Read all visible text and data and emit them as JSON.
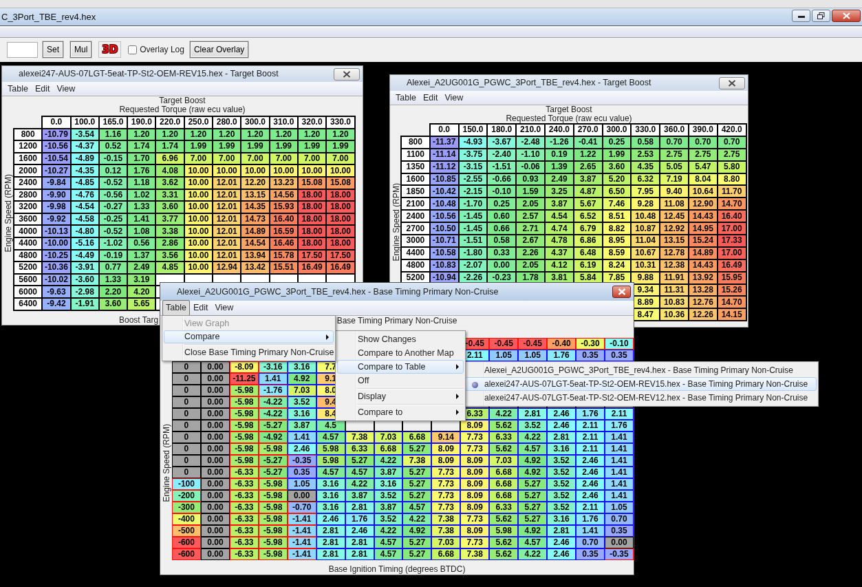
{
  "app": {
    "title": "C_3Port_TBE_rev4.hex",
    "toolbar": {
      "set": "Set",
      "mul": "Mul",
      "three_d": "3D",
      "overlay_log": {
        "label": "Overlay Log",
        "checked": false
      },
      "clear_overlay": "Clear Overlay"
    }
  },
  "windows": [
    {
      "kind": "heatmap",
      "active": false,
      "title": "alexei247-AUS-07LGT-5eat-TP-St2-OEM-REV15.hex - Target Boost",
      "menus": [
        {
          "label": "Table",
          "open": false
        },
        {
          "label": "Edit",
          "open": false
        },
        {
          "label": "View",
          "open": false
        }
      ],
      "chart_title": "Target Boost",
      "x_axis_title": "Requested Torque (raw ecu value)",
      "y_axis_title": "Engine Speed (RPM)",
      "columns": [
        "0.0",
        "100.0",
        "165.0",
        "190.0",
        "220.0",
        "250.0",
        "280.0",
        "300.0",
        "310.0",
        "320.0",
        "330.0"
      ],
      "rows": [
        {
          "label": "800",
          "cells": [
            "-10.79",
            "-3.54",
            "1.16",
            "1.20",
            "1.20",
            "1.20",
            "1.20",
            "1.20",
            "1.20",
            "1.20",
            "1.20"
          ]
        },
        {
          "label": "1200",
          "cells": [
            "-10.56",
            "-4.37",
            "0.52",
            "1.74",
            "1.74",
            "1.99",
            "1.99",
            "1.99",
            "1.99",
            "1.99",
            "1.99"
          ]
        },
        {
          "label": "1600",
          "cells": [
            "-10.54",
            "-4.89",
            "-0.15",
            "1.70",
            "6.96",
            "7.00",
            "7.00",
            "7.00",
            "7.00",
            "7.00",
            "7.00"
          ]
        },
        {
          "label": "2000",
          "cells": [
            "-10.27",
            "-4.35",
            "0.12",
            "1.76",
            "4.08",
            "10.00",
            "10.00",
            "10.00",
            "10.00",
            "10.00",
            "10.00"
          ]
        },
        {
          "label": "2400",
          "cells": [
            "-9.84",
            "-4.85",
            "-0.52",
            "1.18",
            "3.62",
            "10.00",
            "12.01",
            "12.20",
            "13.23",
            "15.08",
            "15.08"
          ]
        },
        {
          "label": "2800",
          "cells": [
            "-9.90",
            "-4.76",
            "-0.56",
            "1.02",
            "3.31",
            "10.00",
            "12.01",
            "13.15",
            "14.56",
            "18.00",
            "18.00"
          ]
        },
        {
          "label": "3200",
          "cells": [
            "-9.98",
            "-4.54",
            "-0.27",
            "1.33",
            "3.60",
            "10.00",
            "12.01",
            "14.35",
            "15.93",
            "18.00",
            "18.00"
          ]
        },
        {
          "label": "3600",
          "cells": [
            "-9.92",
            "-4.58",
            "-0.25",
            "1.41",
            "3.77",
            "10.00",
            "12.01",
            "14.73",
            "16.40",
            "18.00",
            "18.00"
          ]
        },
        {
          "label": "4000",
          "cells": [
            "-10.13",
            "-4.80",
            "-0.52",
            "1.08",
            "3.38",
            "10.00",
            "12.01",
            "14.89",
            "16.59",
            "18.00",
            "18.00"
          ]
        },
        {
          "label": "4400",
          "cells": [
            "-10.00",
            "-5.16",
            "-1.02",
            "0.56",
            "2.86",
            "10.00",
            "12.01",
            "14.54",
            "16.46",
            "18.00",
            "18.00"
          ]
        },
        {
          "label": "4800",
          "cells": [
            "-10.25",
            "-4.49",
            "-0.19",
            "1.37",
            "3.56",
            "10.00",
            "12.01",
            "13.94",
            "15.78",
            "17.50",
            "17.50"
          ]
        },
        {
          "label": "5200",
          "cells": [
            "-10.36",
            "-3.91",
            "0.77",
            "2.49",
            "4.85",
            "10.00",
            "12.94",
            "13.42",
            "15.51",
            "16.49",
            "16.49"
          ]
        },
        {
          "label": "5600",
          "cells": [
            "-10.02",
            "-3.60",
            "1.33",
            "3.19",
            null,
            null,
            null,
            null,
            null,
            null,
            null
          ]
        },
        {
          "label": "6000",
          "cells": [
            "-9.63",
            "-2.98",
            "2.20",
            "4.20",
            null,
            null,
            null,
            null,
            null,
            null,
            null
          ]
        },
        {
          "label": "6400",
          "cells": [
            "-9.42",
            "-1.91",
            "3.60",
            "5.65",
            null,
            null,
            null,
            null,
            null,
            null,
            null
          ]
        }
      ],
      "footer": "Boost Targ"
    },
    {
      "kind": "heatmap",
      "active": false,
      "title": "Alexei_A2UG001G_PGWC_3Port_TBE_rev4.hex - Target Boost",
      "menus": [
        {
          "label": "Table",
          "open": false
        },
        {
          "label": "Edit",
          "open": false
        },
        {
          "label": "View",
          "open": false
        }
      ],
      "chart_title": "Target Boost",
      "x_axis_title": "Requested Torque (raw ecu value)",
      "y_axis_title": "Engine Speed (RPM)",
      "columns": [
        "0.0",
        "150.0",
        "180.0",
        "210.0",
        "240.0",
        "270.0",
        "300.0",
        "330.0",
        "360.0",
        "390.0",
        "420.0"
      ],
      "rows": [
        {
          "label": "800",
          "cells": [
            "-11.37",
            "-4.93",
            "-3.67",
            "-2.48",
            "-1.26",
            "-0.41",
            "0.25",
            "0.58",
            "0.70",
            "0.70",
            "0.70"
          ]
        },
        {
          "label": "1100",
          "cells": [
            "-11.14",
            "-3.75",
            "-2.40",
            "-1.10",
            "0.19",
            "1.22",
            "1.99",
            "2.53",
            "2.75",
            "2.75",
            "2.75"
          ]
        },
        {
          "label": "1350",
          "cells": [
            "-11.12",
            "-3.15",
            "-1.51",
            "-0.06",
            "1.39",
            "2.65",
            "3.60",
            "4.35",
            "5.05",
            "5.47",
            "5.80"
          ]
        },
        {
          "label": "1600",
          "cells": [
            "-10.85",
            "-2.55",
            "-0.66",
            "0.93",
            "2.49",
            "3.87",
            "5.20",
            "6.32",
            "7.19",
            "8.04",
            "8.80"
          ]
        },
        {
          "label": "1850",
          "cells": [
            "-10.42",
            "-2.15",
            "-0.10",
            "1.59",
            "3.25",
            "4.87",
            "6.50",
            "7.95",
            "9.40",
            "10.64",
            "11.70"
          ]
        },
        {
          "label": "2100",
          "cells": [
            "-10.48",
            "-1.70",
            "0.25",
            "2.05",
            "3.87",
            "5.67",
            "7.46",
            "9.28",
            "11.08",
            "12.90",
            "14.70"
          ]
        },
        {
          "label": "2400",
          "cells": [
            "-10.56",
            "-1.45",
            "0.60",
            "2.57",
            "4.54",
            "6.52",
            "8.51",
            "10.48",
            "12.45",
            "14.43",
            "16.40"
          ]
        },
        {
          "label": "2700",
          "cells": [
            "-10.50",
            "-1.45",
            "0.66",
            "2.71",
            "4.74",
            "6.79",
            "8.82",
            "10.87",
            "12.92",
            "14.95",
            "17.00"
          ]
        },
        {
          "label": "3000",
          "cells": [
            "-10.71",
            "-1.51",
            "0.58",
            "2.67",
            "4.78",
            "6.86",
            "8.95",
            "11.04",
            "13.15",
            "15.24",
            "17.33"
          ]
        },
        {
          "label": "4400",
          "cells": [
            "-10.58",
            "-1.80",
            "0.33",
            "2.26",
            "4.37",
            "6.48",
            "8.59",
            "10.67",
            "12.78",
            "14.89",
            "17.00"
          ]
        },
        {
          "label": "4800",
          "cells": [
            "-10.83",
            "-2.07",
            "0.00",
            "2.05",
            "4.12",
            "6.19",
            "8.24",
            "10.31",
            "12.38",
            "14.43",
            "16.49"
          ]
        },
        {
          "label": "5200",
          "cells": [
            "-10.94",
            "-2.26",
            "-0.23",
            "1.78",
            "3.81",
            "5.84",
            "7.85",
            "9.88",
            "11.91",
            "13.92",
            "15.95"
          ]
        },
        {
          "label": null,
          "cells": [
            null,
            null,
            null,
            null,
            null,
            null,
            null,
            "9.34",
            "11.31",
            "13.28",
            "15.26"
          ]
        },
        {
          "label": null,
          "cells": [
            null,
            null,
            null,
            null,
            null,
            null,
            null,
            "8.89",
            "10.83",
            "12.76",
            "14.70"
          ]
        },
        {
          "label": null,
          "cells": [
            null,
            null,
            null,
            null,
            null,
            null,
            null,
            "8.47",
            "10.36",
            "12.26",
            "14.15"
          ]
        }
      ]
    },
    {
      "kind": "compare",
      "active": true,
      "title": "Alexei_A2UG001G_PGWC_3Port_TBE_rev4.hex - Base Timing Primary Non-Cruise",
      "menus": [
        {
          "label": "Table",
          "open": true
        },
        {
          "label": "Edit",
          "open": false
        },
        {
          "label": "View",
          "open": false
        }
      ],
      "chart_title": "Base Timing Primary Non-Cruise",
      "y_axis_title": "Engine Speed (RPM)",
      "columns": [
        null,
        null,
        null,
        null,
        null,
        null,
        null,
        null,
        null,
        "-0.45",
        "-0.45",
        "-0.45",
        "-0.40",
        "-0.30",
        "-0.10"
      ],
      "rows": [
        {
          "label": null,
          "cells": [
            null,
            null,
            null,
            null,
            null,
            null,
            null,
            null,
            null,
            "2.11",
            "1.05",
            "1.05",
            "1.76",
            "0.35",
            "0.35"
          ]
        },
        {
          "label": "0",
          "cells": [
            "0.00",
            "-8.09",
            "-3.16",
            "3.16",
            "7.7",
            null,
            null,
            null,
            null,
            null,
            null,
            null,
            null,
            null,
            null
          ]
        },
        {
          "label": "0",
          "cells": [
            "0.00",
            "-11.25",
            "1.41",
            "4.92",
            "9.1",
            null,
            null,
            null,
            null,
            null,
            null,
            null,
            null,
            null,
            null
          ]
        },
        {
          "label": "0",
          "cells": [
            "0.00",
            "-5.98",
            "-1.76",
            "7.03",
            "8.0",
            null,
            null,
            null,
            null,
            null,
            null,
            null,
            null,
            null,
            null
          ]
        },
        {
          "label": "0",
          "cells": [
            "0.00",
            "-5.98",
            "-4.22",
            "3.52",
            "9.4",
            null,
            null,
            null,
            null,
            null,
            null,
            null,
            null,
            null,
            null
          ]
        },
        {
          "label": "0",
          "cells": [
            "0.00",
            "-5.98",
            "-4.22",
            "3.16",
            "8.4",
            null,
            null,
            null,
            null,
            "6.33",
            "4.22",
            "2.81",
            "2.46",
            "1.76",
            "2.11"
          ]
        },
        {
          "label": "0",
          "cells": [
            "0.00",
            "-5.98",
            "-5.27",
            "3.87",
            "4.5",
            null,
            null,
            null,
            null,
            "8.09",
            "5.62",
            "3.52",
            "2.46",
            "2.11",
            "1.76"
          ]
        },
        {
          "label": "0",
          "cells": [
            "0.00",
            "-5.98",
            "-4.92",
            "1.41",
            "4.57",
            "7.38",
            "7.03",
            "6.68",
            "9.14",
            "7.73",
            "6.33",
            "4.22",
            "2.81",
            "2.11",
            "1.41"
          ]
        },
        {
          "label": "0",
          "cells": [
            "0.00",
            "-5.98",
            "-5.98",
            "2.46",
            "5.98",
            "6.33",
            "6.68",
            "5.27",
            "8.09",
            "7.73",
            "5.62",
            "4.57",
            "3.16",
            "2.11",
            "1.41"
          ]
        },
        {
          "label": "0",
          "cells": [
            "0.00",
            "-5.98",
            "-5.27",
            "-0.35",
            "5.98",
            "5.27",
            "4.22",
            "7.38",
            "8.09",
            "8.09",
            "7.03",
            "4.92",
            "3.52",
            "2.46",
            "1.41"
          ]
        },
        {
          "label": "0",
          "cells": [
            "0.00",
            "-6.33",
            "-5.27",
            "0.35",
            "4.57",
            "4.57",
            "3.87",
            "5.27",
            "7.73",
            "8.09",
            "6.68",
            "4.92",
            "3.52",
            "2.46",
            "1.41"
          ]
        },
        {
          "label": "-100",
          "cells": [
            "0.00",
            "-6.33",
            "-5.98",
            "1.05",
            "3.16",
            "4.22",
            "3.16",
            "5.27",
            "7.73",
            "8.09",
            "6.68",
            "5.27",
            "3.52",
            "2.46",
            "1.41"
          ]
        },
        {
          "label": "-200",
          "cells": [
            "0.00",
            "-6.33",
            "-5.98",
            "0.00",
            "3.16",
            "3.87",
            "3.52",
            "5.27",
            "7.73",
            "8.09",
            "6.68",
            "5.27",
            "3.52",
            "2.46",
            "1.41"
          ]
        },
        {
          "label": "-300",
          "cells": [
            "0.00",
            "-6.33",
            "-5.98",
            "-0.70",
            "3.16",
            "2.81",
            "3.87",
            "4.57",
            "7.73",
            "8.09",
            "6.33",
            "5.27",
            "3.52",
            "2.11",
            "1.05"
          ]
        },
        {
          "label": "-400",
          "cells": [
            "0.00",
            "-6.33",
            "-5.98",
            "-1.41",
            "2.46",
            "1.76",
            "3.52",
            "4.22",
            "7.38",
            "7.73",
            "5.62",
            "5.27",
            "3.16",
            "1.76",
            "0.70"
          ]
        },
        {
          "label": "-500",
          "cells": [
            "0.00",
            "-6.33",
            "-5.98",
            "-1.41",
            "2.81",
            "2.46",
            "4.22",
            "4.92",
            "7.38",
            "8.09",
            "5.98",
            "4.92",
            "2.81",
            "1.41",
            "0.35"
          ]
        },
        {
          "label": "-600",
          "cells": [
            "0.00",
            "-6.33",
            "-5.98",
            "-1.41",
            "2.81",
            "2.81",
            "4.57",
            "5.27",
            "7.03",
            "7.73",
            "5.62",
            "4.57",
            "2.46",
            "0.70",
            "0.00"
          ]
        },
        {
          "label": "-600",
          "cells": [
            "0.00",
            "-6.33",
            "-5.98",
            "-1.41",
            "2.81",
            "2.81",
            "4.57",
            "5.27",
            "6.68",
            "7.38",
            "5.62",
            "4.22",
            "2.46",
            "0.35",
            "-0.35"
          ]
        }
      ],
      "footer": "Base Ignition Timing (degrees BTDC)",
      "popup": {
        "items": [
          {
            "label": "View Graph",
            "disabled": true,
            "selected": false,
            "submenu": false
          },
          {
            "label": "Compare",
            "disabled": false,
            "selected": true,
            "submenu": true,
            "children": [
              {
                "label": "Show Changes",
                "selected": false,
                "submenu": false
              },
              {
                "label": "Compare to Another Map",
                "selected": false,
                "submenu": false
              },
              {
                "label": "Compare to Table",
                "selected": true,
                "submenu": true,
                "children": [
                  {
                    "label": "Alexei_A2UG001G_PGWC_3Port_TBE_rev4.hex - Base Timing Primary Non-Cruise",
                    "selected": false,
                    "checked": false
                  },
                  {
                    "label": "alexei247-AUS-07LGT-5eat-TP-St2-OEM-REV15.hex - Base Timing Primary Non-Cruise",
                    "selected": true,
                    "checked": true
                  },
                  {
                    "label": "alexei247-AUS-07LGT-5eat-TP-St2-OEM-REV12.hex - Base Timing Primary Non-Cruise",
                    "selected": false,
                    "checked": false
                  }
                ]
              },
              {
                "label": "Off",
                "selected": false,
                "submenu": false
              },
              {
                "kind": "separator"
              },
              {
                "label": "Display",
                "selected": false,
                "submenu": true
              },
              {
                "kind": "separator"
              },
              {
                "label": "Compare to",
                "selected": false,
                "submenu": true
              }
            ]
          },
          {
            "kind": "separator"
          },
          {
            "label": "Close Base Timing Primary Non-Cruise",
            "disabled": false,
            "selected": false,
            "submenu": false
          }
        ]
      }
    }
  ]
}
